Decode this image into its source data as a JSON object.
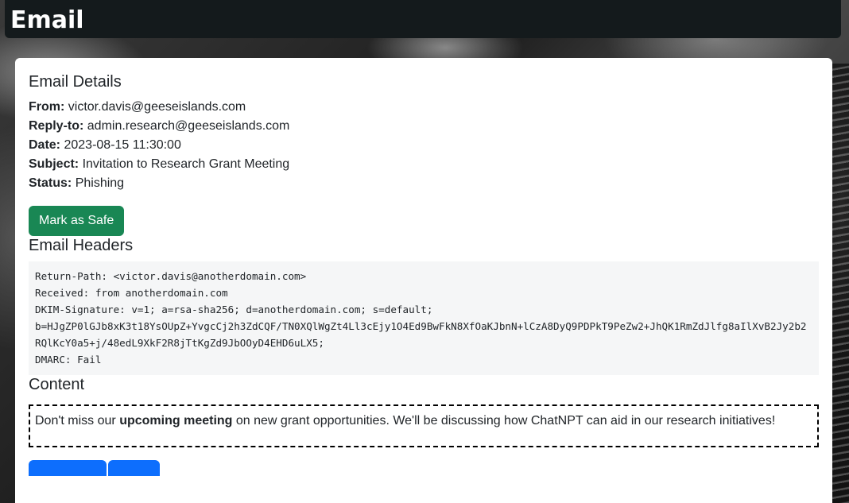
{
  "header": {
    "title": "Email"
  },
  "details": {
    "title": "Email Details",
    "fields": [
      {
        "label": "From:",
        "value": "victor.davis@geeseislands.com"
      },
      {
        "label": "Reply-to:",
        "value": "admin.research@geeseislands.com"
      },
      {
        "label": "Date:",
        "value": "2023-08-15 11:30:00"
      },
      {
        "label": "Subject:",
        "value": "Invitation to Research Grant Meeting"
      },
      {
        "label": "Status:",
        "value": "Phishing"
      }
    ],
    "mark_safe_label": "Mark as Safe"
  },
  "headers": {
    "title": "Email Headers",
    "lines": [
      "Return-Path: <victor.davis@anotherdomain.com>",
      "Received: from anotherdomain.com",
      "DKIM-Signature: v=1; a=rsa-sha256; d=anotherdomain.com; s=default;",
      "b=HJgZP0lGJb8xK3t18YsOUpZ+YvgcCj2h3ZdCQF/TN0XQlWgZt4Ll3cEjy1O4Ed9BwFkN8XfOaKJbnN+lCzA8DyQ9PDPkT9PeZw2+JhQK1RmZdJlfg8aIlXvB2Jy2b2RQlKcY0a5+j/48edL9XkF2R8jTtKgZd9JbOOyD4EHD6uLX5;",
      "DMARC: Fail"
    ]
  },
  "content": {
    "title": "Content",
    "body_before": "Don't miss our ",
    "body_bold": "upcoming meeting",
    "body_after": " on new grant opportunities. We'll be discussing how ChatNPT can aid in our research initiatives!"
  },
  "colors": {
    "header_bg": "#141a1c",
    "success": "#198754",
    "primary": "#0d6efd"
  }
}
